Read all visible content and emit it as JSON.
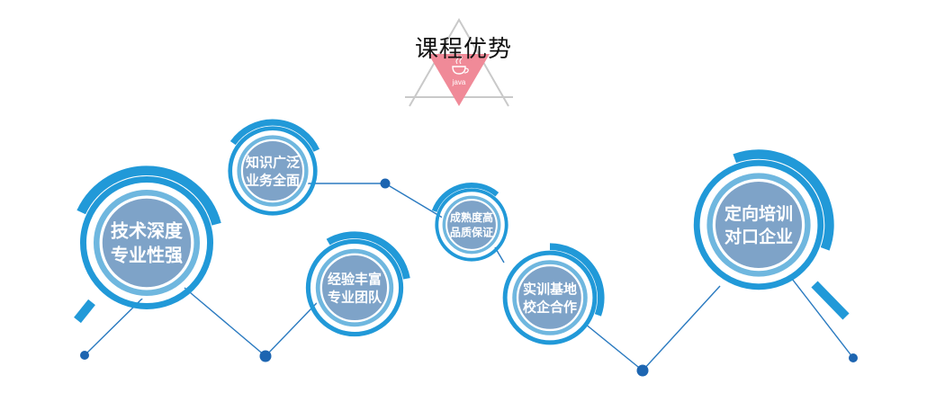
{
  "header": {
    "title": "课程优势",
    "logo_text": "java"
  },
  "colors": {
    "ring_dark": "#2199d8",
    "ring_light": "#6fb7df",
    "disk_fill": "#7ea3c8",
    "disk_inner": "#8aabd0",
    "line": "#2a7ac0",
    "dot": "#1d65b1",
    "triangle_fill": "#f08a98",
    "triangle_stroke": "#c9c9c9"
  },
  "advantages": [
    {
      "id": "tech",
      "lines": [
        "技术深度",
        "专业性强"
      ]
    },
    {
      "id": "knowledge",
      "lines": [
        "知识广泛",
        "业务全面"
      ]
    },
    {
      "id": "team",
      "lines": [
        "经验丰富",
        "专业团队"
      ]
    },
    {
      "id": "maturity",
      "lines": [
        "成熟度高",
        "品质保证"
      ]
    },
    {
      "id": "training",
      "lines": [
        "实训基地",
        "校企合作"
      ]
    },
    {
      "id": "enterprise",
      "lines": [
        "定向培训",
        "对口企业"
      ]
    }
  ]
}
